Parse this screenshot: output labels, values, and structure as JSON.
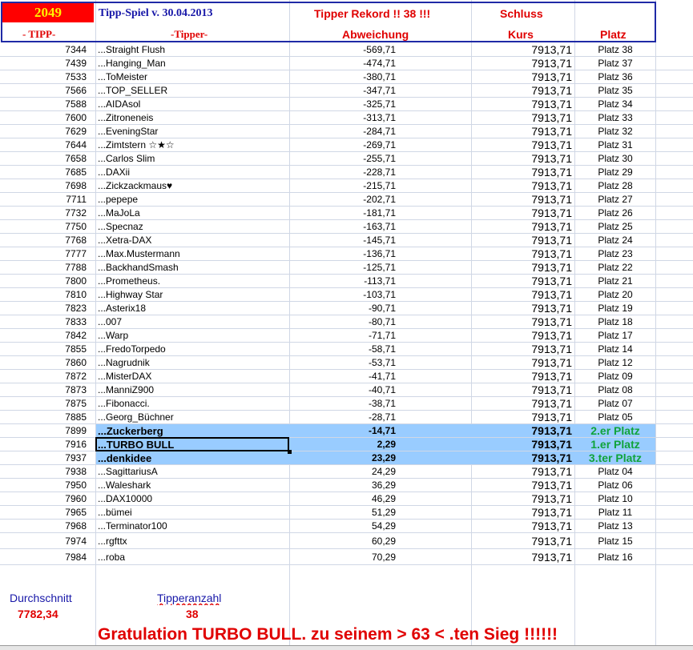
{
  "header": {
    "year": "2049",
    "title": "Tipp-Spiel v. 30.04.2013",
    "record": "Tipper Rekord !!  38  !!!",
    "schluss": "Schluss",
    "col_tipp": "- TIPP-",
    "col_tipper": "-Tipper-",
    "col_abweichung": "Abweichung",
    "col_kurs": "Kurs",
    "col_platz": "Platz"
  },
  "rows": [
    {
      "tipp": "7344",
      "name": "...Straight Flush",
      "abw": "-569,71",
      "kurs": "7913,71",
      "platz": "Platz 38"
    },
    {
      "tipp": "7439",
      "name": "...Hanging_Man",
      "abw": "-474,71",
      "kurs": "7913,71",
      "platz": "Platz 37"
    },
    {
      "tipp": "7533",
      "name": "...ToMeister",
      "abw": "-380,71",
      "kurs": "7913,71",
      "platz": "Platz 36"
    },
    {
      "tipp": "7566",
      "name": "...TOP_SELLER",
      "abw": "-347,71",
      "kurs": "7913,71",
      "platz": "Platz 35"
    },
    {
      "tipp": "7588",
      "name": "...AIDAsol",
      "abw": "-325,71",
      "kurs": "7913,71",
      "platz": "Platz 34"
    },
    {
      "tipp": "7600",
      "name": "...Zitroneneis",
      "abw": "-313,71",
      "kurs": "7913,71",
      "platz": "Platz 33"
    },
    {
      "tipp": "7629",
      "name": "...EveningStar",
      "abw": "-284,71",
      "kurs": "7913,71",
      "platz": "Platz 32"
    },
    {
      "tipp": "7644",
      "name": "...Zimtstern ☆★☆",
      "abw": "-269,71",
      "kurs": "7913,71",
      "platz": "Platz 31"
    },
    {
      "tipp": "7658",
      "name": "...Carlos Slim",
      "abw": "-255,71",
      "kurs": "7913,71",
      "platz": "Platz 30"
    },
    {
      "tipp": "7685",
      "name": "...DAXii",
      "abw": "-228,71",
      "kurs": "7913,71",
      "platz": "Platz 29"
    },
    {
      "tipp": "7698",
      "name": "...Zickzackmaus♥",
      "abw": "-215,71",
      "kurs": "7913,71",
      "platz": "Platz 28"
    },
    {
      "tipp": "7711",
      "name": "...pepepe",
      "abw": "-202,71",
      "kurs": "7913,71",
      "platz": "Platz 27"
    },
    {
      "tipp": "7732",
      "name": "...MaJoLa",
      "abw": "-181,71",
      "kurs": "7913,71",
      "platz": "Platz 26"
    },
    {
      "tipp": "7750",
      "name": "...Specnaz",
      "abw": "-163,71",
      "kurs": "7913,71",
      "platz": "Platz 25"
    },
    {
      "tipp": "7768",
      "name": "...Xetra-DAX",
      "abw": "-145,71",
      "kurs": "7913,71",
      "platz": "Platz 24"
    },
    {
      "tipp": "7777",
      "name": "...Max.Mustermann",
      "abw": "-136,71",
      "kurs": "7913,71",
      "platz": "Platz 23"
    },
    {
      "tipp": "7788",
      "name": "...BackhandSmash",
      "abw": "-125,71",
      "kurs": "7913,71",
      "platz": "Platz 22"
    },
    {
      "tipp": "7800",
      "name": "...Prometheus.",
      "abw": "-113,71",
      "kurs": "7913,71",
      "platz": "Platz 21"
    },
    {
      "tipp": "7810",
      "name": "...Highway Star",
      "abw": "-103,71",
      "kurs": "7913,71",
      "platz": "Platz 20"
    },
    {
      "tipp": "7823",
      "name": "...Asterix18",
      "abw": "-90,71",
      "kurs": "7913,71",
      "platz": "Platz 19"
    },
    {
      "tipp": "7833",
      "name": "...007",
      "abw": "-80,71",
      "kurs": "7913,71",
      "platz": "Platz 18"
    },
    {
      "tipp": "7842",
      "name": "...Warp",
      "abw": "-71,71",
      "kurs": "7913,71",
      "platz": "Platz 17"
    },
    {
      "tipp": "7855",
      "name": "...FredoTorpedo",
      "abw": "-58,71",
      "kurs": "7913,71",
      "platz": "Platz 14"
    },
    {
      "tipp": "7860",
      "name": "...Nagrudnik",
      "abw": "-53,71",
      "kurs": "7913,71",
      "platz": "Platz 12"
    },
    {
      "tipp": "7872",
      "name": "...MisterDAX",
      "abw": "-41,71",
      "kurs": "7913,71",
      "platz": "Platz 09"
    },
    {
      "tipp": "7873",
      "name": "...ManniZ900",
      "abw": "-40,71",
      "kurs": "7913,71",
      "platz": "Platz 08"
    },
    {
      "tipp": "7875",
      "name": "...Fibonacci.",
      "abw": "-38,71",
      "kurs": "7913,71",
      "platz": "Platz 07"
    },
    {
      "tipp": "7885",
      "name": "...Georg_Büchner",
      "abw": "-28,71",
      "kurs": "7913,71",
      "platz": "Platz 05"
    },
    {
      "tipp": "7899",
      "name": "...Zuckerberg",
      "abw": "-14,71",
      "kurs": "7913,71",
      "platz": "2.er Platz"
    },
    {
      "tipp": "7916",
      "name": "...TURBO BULL",
      "abw": "2,29",
      "kurs": "7913,71",
      "platz": "1.er Platz"
    },
    {
      "tipp": "7937",
      "name": "...denkidee",
      "abw": "23,29",
      "kurs": "7913,71",
      "platz": "3.ter Platz"
    },
    {
      "tipp": "7938",
      "name": "...SagittariusA",
      "abw": "24,29",
      "kurs": "7913,71",
      "platz": "Platz 04"
    },
    {
      "tipp": "7950",
      "name": "...Waleshark",
      "abw": "36,29",
      "kurs": "7913,71",
      "platz": "Platz 06"
    },
    {
      "tipp": "7960",
      "name": "...DAX10000",
      "abw": "46,29",
      "kurs": "7913,71",
      "platz": "Platz 10"
    },
    {
      "tipp": "7965",
      "name": "...bümei",
      "abw": "51,29",
      "kurs": "7913,71",
      "platz": "Platz 11"
    },
    {
      "tipp": "7968",
      "name": "...Terminator100",
      "abw": "54,29",
      "kurs": "7913,71",
      "platz": "Platz 13"
    },
    {
      "tipp": "7974",
      "name": "...rgfttx",
      "abw": "60,29",
      "kurs": "7913,71",
      "platz": "Platz 15"
    },
    {
      "tipp": "7984",
      "name": "...roba",
      "abw": "70,29",
      "kurs": "7913,71",
      "platz": "Platz 16"
    }
  ],
  "footer": {
    "avg_label": "Durchschnitt",
    "avg_value": "7782,34",
    "count_label": "Tipperanzahl",
    "count_value": "38",
    "gratulation": "Gratulation TURBO BULL.   zu seinem > 63 < .ten Sieg !!!!!!"
  },
  "colors": {
    "highlight": "#99ccff",
    "winner_green": "#10a33a",
    "header_red": "#e00000",
    "header_blue": "#1717a8"
  }
}
